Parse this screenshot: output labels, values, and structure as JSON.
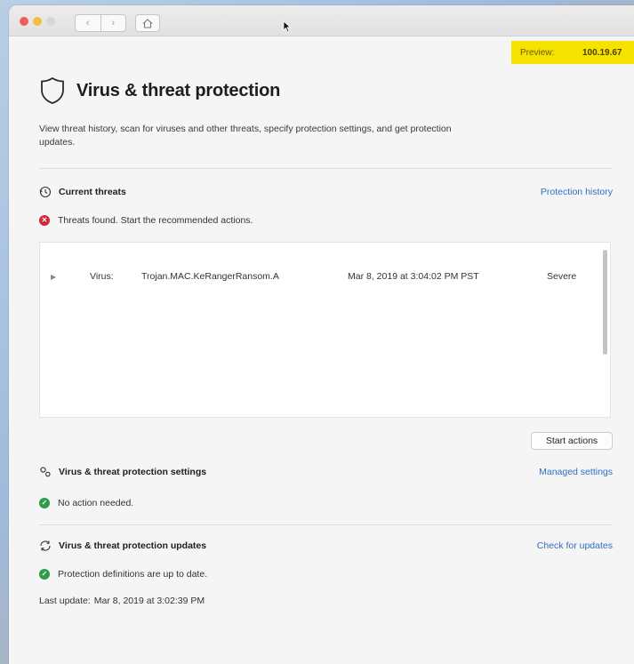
{
  "window": {
    "home_glyph": "⌂",
    "back_glyph": "‹",
    "forward_glyph": "›"
  },
  "preview": {
    "label": "Preview:",
    "value": "100.19.67"
  },
  "page": {
    "title": "Virus & threat protection",
    "description": "View threat history, scan for viruses and other threats, specify protection settings, and get protection updates."
  },
  "current_threats": {
    "title": "Current threats",
    "link": "Protection history",
    "status": "Threats found. Start the recommended actions.",
    "threats": [
      {
        "type": "Virus:",
        "name": "Trojan.MAC.KeRangerRansom.A",
        "date": "Mar 8, 2019 at 3:04:02 PM PST",
        "severity": "Severe"
      }
    ],
    "action_button": "Start actions"
  },
  "settings": {
    "title": "Virus & threat protection settings",
    "link": "Managed settings",
    "status": "No action needed."
  },
  "updates": {
    "title": "Virus & threat protection updates",
    "link": "Check for updates",
    "status": "Protection definitions are up to date.",
    "last_update_label": "Last update:",
    "last_update_value": "Mar 8, 2019 at 3:02:39 PM"
  },
  "colors": {
    "link": "#2f6fc0",
    "danger": "#d0283a",
    "ok": "#2c9b4a",
    "preview_bg": "#f6e200"
  },
  "icons": {
    "page": "shield-icon",
    "current_threats": "history-clock-icon",
    "settings": "settings-gears-icon",
    "updates": "refresh-icon"
  }
}
